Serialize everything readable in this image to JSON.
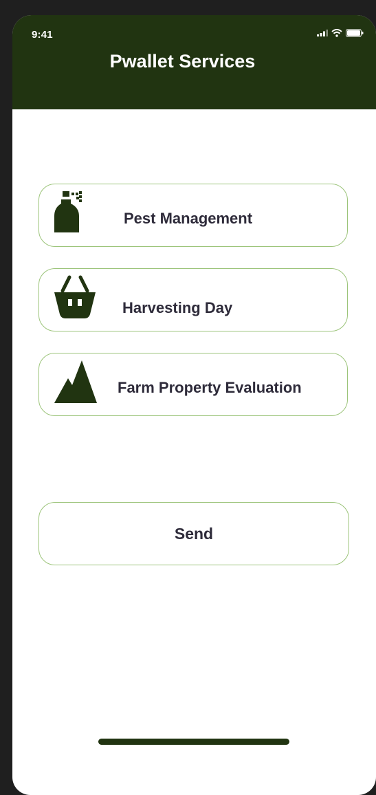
{
  "status_bar": {
    "time": "9:41",
    "icons": [
      "signal-icon",
      "wifi-icon",
      "battery-icon"
    ]
  },
  "header": {
    "title": "Pwallet Services"
  },
  "services": [
    {
      "label": "Pest Management",
      "icon": "sprayer-icon"
    },
    {
      "label": "Harvesting Day",
      "icon": "basket-icon"
    },
    {
      "label": "Farm Property Evaluation",
      "icon": "mountain-icon"
    }
  ],
  "actions": {
    "send_label": "Send"
  },
  "colors": {
    "header_bg": "#213411",
    "card_border": "#9cc47a",
    "text": "#2e2b3a",
    "icon": "#213411"
  }
}
